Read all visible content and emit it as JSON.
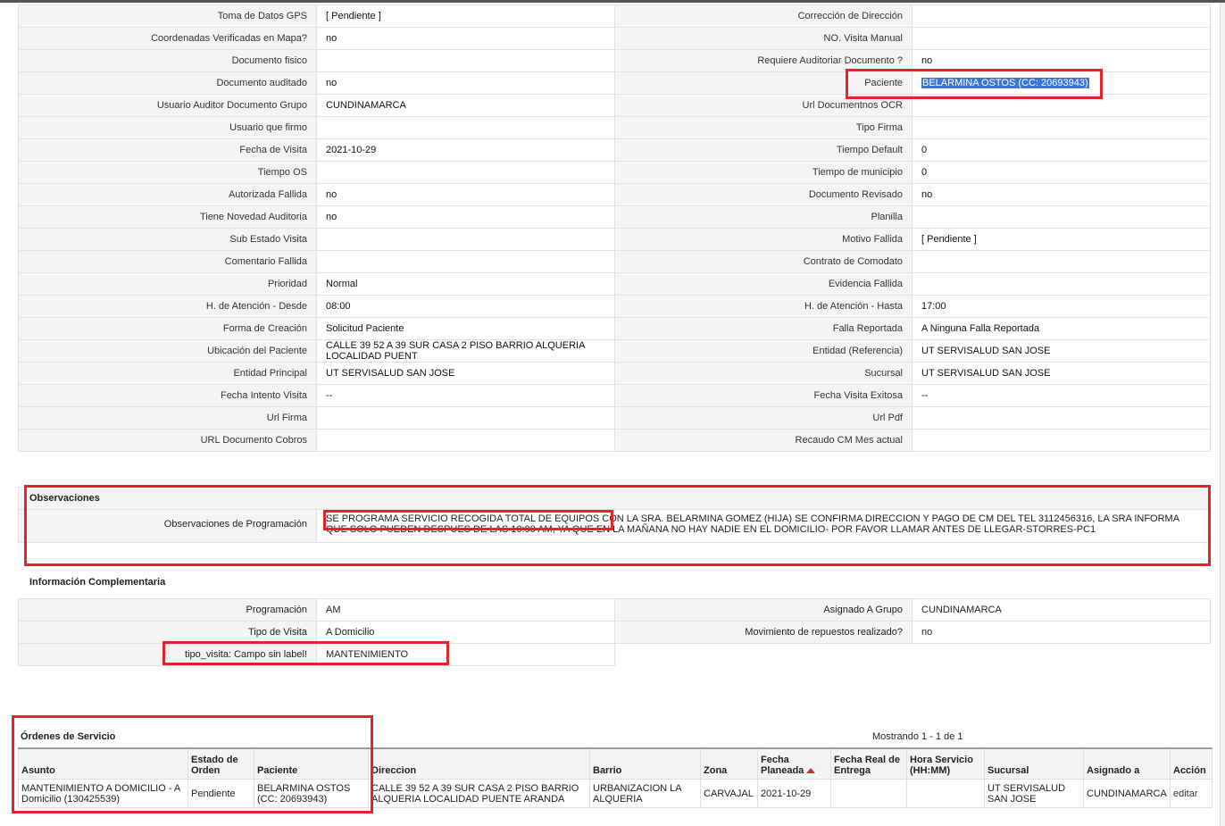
{
  "detail_rows": [
    [
      "Toma de Datos GPS",
      "[ Pendiente ]",
      "Corrección de Dirección",
      ""
    ],
    [
      "Coordenadas Verificadas en Mapa?",
      "no",
      "NO. Visita Manual",
      ""
    ],
    [
      "Documento fisico",
      "",
      "Requiere Auditoriar Documento ?",
      "no"
    ],
    [
      "Documento auditado",
      "no",
      "Paciente",
      "BELARMINA OSTOS (CC: 20693943)"
    ],
    [
      "Usuario Auditor Documento Grupo",
      "CUNDINAMARCA",
      "Url Documentnos OCR",
      ""
    ],
    [
      "Usuario que firmo",
      "",
      "Tipo Firma",
      ""
    ],
    [
      "Fecha de Visita",
      "2021-10-29",
      "Tiempo Default",
      "0"
    ],
    [
      "Tiempo OS",
      "",
      "Tiempo de municipio",
      "0"
    ],
    [
      "Autorizada Fallida",
      "no",
      "Documento Revisado",
      "no"
    ],
    [
      "Tiene Novedad Auditoria",
      "no",
      "Planilla",
      ""
    ],
    [
      "Sub Estado Visita",
      "",
      "Motivo Fallida",
      "[ Pendiente ]"
    ],
    [
      "Comentario Fallida",
      "",
      "Contrato de Comodato",
      ""
    ],
    [
      "Prioridad",
      "Normal",
      "Evidencia Fallida",
      ""
    ],
    [
      "H. de Atención - Desde",
      "08:00",
      "H. de Atención - Hasta",
      "17:00"
    ],
    [
      "Forma de Creación",
      "Solicitud Paciente",
      "Falla Reportada",
      "A Ninguna Falla Reportada"
    ],
    [
      "Ubicación del Paciente",
      "CALLE 39 52 A 39 SUR CASA 2 PISO BARRIO ALQUERIA LOCALIDAD PUENT",
      "Entidad (Referencia)",
      "UT SERVISALUD SAN JOSE"
    ],
    [
      "Entidad Principal",
      "UT SERVISALUD SAN JOSE",
      "Sucursal",
      "UT SERVISALUD SAN JOSE"
    ],
    [
      "Fecha Intento Visita",
      "--",
      "Fecha Visita Exitosa",
      "--"
    ],
    [
      "Url Firma",
      "",
      "Url Pdf",
      ""
    ],
    [
      "URL Documento Cobros",
      "",
      "Recaudo CM Mes actual",
      ""
    ]
  ],
  "observaciones": {
    "title": "Observaciones",
    "label": "Observaciones de Programación",
    "text": "SE PROGRAMA SERVICIO RECOGIDA TOTAL DE EQUIPOS CON LA SRA. BELARMINA GOMEZ (HIJA) SE CONFIRMA DIRECCION Y PAGO DE CM DEL TEL 3112456316, LA SRA INFORMA QUE SOLO PUEDEN DESPUES DE LAS 10:00 AM, YA QUE EN LA MAÑANA NO HAY NADIE EN EL DOMICILIO- POR FAVOR LLAMAR ANTES DE LLEGAR-STORRES-PC1"
  },
  "info_complementaria": {
    "title": "Información Complementaria",
    "rows": [
      [
        "Programación",
        "AM",
        "Asignado A Grupo",
        "CUNDINAMARCA"
      ],
      [
        "Tipo de Visita",
        "A Domicilio",
        "Movimiento de repuestos realizado?",
        "no"
      ],
      [
        "tipo_visita: Campo sin label!",
        "MANTENIMIENTO",
        "",
        ""
      ]
    ]
  },
  "ordenes": {
    "title": "Órdenes de Servicio",
    "showing": "Mostrando 1 - 1 de 1",
    "columns": [
      "Asunto",
      "Estado de Orden",
      "Paciente",
      "Direccion",
      "Barrio",
      "Zona",
      "Fecha Planeada",
      "Fecha Real de Entrega",
      "Hora Servicio (HH:MM)",
      "Sucursal",
      "Asignado a",
      "Acción"
    ],
    "rows": [
      [
        "MANTENIMIENTO A DOMICILIO - A Domicilio (130425539)",
        "Pendiente",
        "BELARMINA OSTOS (CC: 20693943)",
        "CALLE 39 52 A 39 SUR CASA 2 PISO BARRIO ALQUERIA LOCALIDAD PUENTE ARANDA",
        "URBANIZACION LA ALQUERIA",
        "CARVAJAL",
        "2021-10-29",
        "",
        "",
        "UT SERVISALUD SAN JOSE",
        "CUNDINAMARCA",
        "editar"
      ]
    ]
  },
  "colors": {
    "highlight": "#e3242b",
    "selection": "#3b76d4",
    "sort_arrow": "#c0392b"
  }
}
